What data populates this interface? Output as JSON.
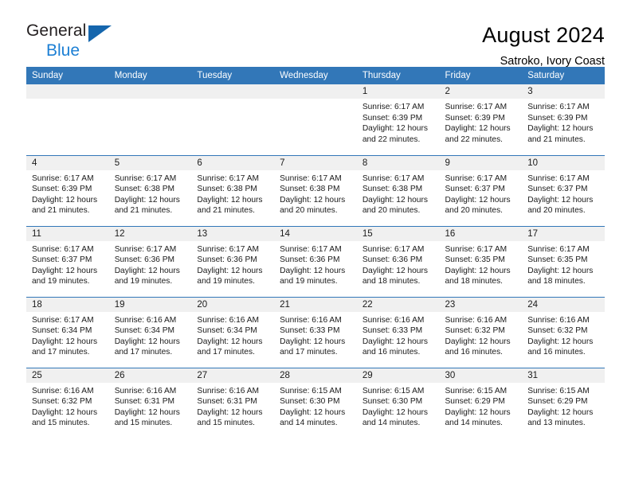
{
  "brand": {
    "name_top": "General",
    "name_bottom": "Blue",
    "accent_color": "#1c7fd4",
    "triangle_color": "#1566ad"
  },
  "header": {
    "title": "August 2024",
    "subtitle": "Satroko, Ivory Coast",
    "header_bg": "#3277b8",
    "daynum_bg": "#f0f0f0"
  },
  "weekdays": [
    "Sunday",
    "Monday",
    "Tuesday",
    "Wednesday",
    "Thursday",
    "Friday",
    "Saturday"
  ],
  "labels": {
    "sunrise": "Sunrise:",
    "sunset": "Sunset:",
    "daylight": "Daylight:"
  },
  "weeks": [
    [
      {
        "day": "",
        "empty": true
      },
      {
        "day": "",
        "empty": true
      },
      {
        "day": "",
        "empty": true
      },
      {
        "day": "",
        "empty": true
      },
      {
        "day": "1",
        "sunrise": "Sunrise: 6:17 AM",
        "sunset": "Sunset: 6:39 PM",
        "daylight1": "Daylight: 12 hours",
        "daylight2": "and 22 minutes."
      },
      {
        "day": "2",
        "sunrise": "Sunrise: 6:17 AM",
        "sunset": "Sunset: 6:39 PM",
        "daylight1": "Daylight: 12 hours",
        "daylight2": "and 22 minutes."
      },
      {
        "day": "3",
        "sunrise": "Sunrise: 6:17 AM",
        "sunset": "Sunset: 6:39 PM",
        "daylight1": "Daylight: 12 hours",
        "daylight2": "and 21 minutes."
      }
    ],
    [
      {
        "day": "4",
        "sunrise": "Sunrise: 6:17 AM",
        "sunset": "Sunset: 6:39 PM",
        "daylight1": "Daylight: 12 hours",
        "daylight2": "and 21 minutes."
      },
      {
        "day": "5",
        "sunrise": "Sunrise: 6:17 AM",
        "sunset": "Sunset: 6:38 PM",
        "daylight1": "Daylight: 12 hours",
        "daylight2": "and 21 minutes."
      },
      {
        "day": "6",
        "sunrise": "Sunrise: 6:17 AM",
        "sunset": "Sunset: 6:38 PM",
        "daylight1": "Daylight: 12 hours",
        "daylight2": "and 21 minutes."
      },
      {
        "day": "7",
        "sunrise": "Sunrise: 6:17 AM",
        "sunset": "Sunset: 6:38 PM",
        "daylight1": "Daylight: 12 hours",
        "daylight2": "and 20 minutes."
      },
      {
        "day": "8",
        "sunrise": "Sunrise: 6:17 AM",
        "sunset": "Sunset: 6:38 PM",
        "daylight1": "Daylight: 12 hours",
        "daylight2": "and 20 minutes."
      },
      {
        "day": "9",
        "sunrise": "Sunrise: 6:17 AM",
        "sunset": "Sunset: 6:37 PM",
        "daylight1": "Daylight: 12 hours",
        "daylight2": "and 20 minutes."
      },
      {
        "day": "10",
        "sunrise": "Sunrise: 6:17 AM",
        "sunset": "Sunset: 6:37 PM",
        "daylight1": "Daylight: 12 hours",
        "daylight2": "and 20 minutes."
      }
    ],
    [
      {
        "day": "11",
        "sunrise": "Sunrise: 6:17 AM",
        "sunset": "Sunset: 6:37 PM",
        "daylight1": "Daylight: 12 hours",
        "daylight2": "and 19 minutes."
      },
      {
        "day": "12",
        "sunrise": "Sunrise: 6:17 AM",
        "sunset": "Sunset: 6:36 PM",
        "daylight1": "Daylight: 12 hours",
        "daylight2": "and 19 minutes."
      },
      {
        "day": "13",
        "sunrise": "Sunrise: 6:17 AM",
        "sunset": "Sunset: 6:36 PM",
        "daylight1": "Daylight: 12 hours",
        "daylight2": "and 19 minutes."
      },
      {
        "day": "14",
        "sunrise": "Sunrise: 6:17 AM",
        "sunset": "Sunset: 6:36 PM",
        "daylight1": "Daylight: 12 hours",
        "daylight2": "and 19 minutes."
      },
      {
        "day": "15",
        "sunrise": "Sunrise: 6:17 AM",
        "sunset": "Sunset: 6:36 PM",
        "daylight1": "Daylight: 12 hours",
        "daylight2": "and 18 minutes."
      },
      {
        "day": "16",
        "sunrise": "Sunrise: 6:17 AM",
        "sunset": "Sunset: 6:35 PM",
        "daylight1": "Daylight: 12 hours",
        "daylight2": "and 18 minutes."
      },
      {
        "day": "17",
        "sunrise": "Sunrise: 6:17 AM",
        "sunset": "Sunset: 6:35 PM",
        "daylight1": "Daylight: 12 hours",
        "daylight2": "and 18 minutes."
      }
    ],
    [
      {
        "day": "18",
        "sunrise": "Sunrise: 6:17 AM",
        "sunset": "Sunset: 6:34 PM",
        "daylight1": "Daylight: 12 hours",
        "daylight2": "and 17 minutes."
      },
      {
        "day": "19",
        "sunrise": "Sunrise: 6:16 AM",
        "sunset": "Sunset: 6:34 PM",
        "daylight1": "Daylight: 12 hours",
        "daylight2": "and 17 minutes."
      },
      {
        "day": "20",
        "sunrise": "Sunrise: 6:16 AM",
        "sunset": "Sunset: 6:34 PM",
        "daylight1": "Daylight: 12 hours",
        "daylight2": "and 17 minutes."
      },
      {
        "day": "21",
        "sunrise": "Sunrise: 6:16 AM",
        "sunset": "Sunset: 6:33 PM",
        "daylight1": "Daylight: 12 hours",
        "daylight2": "and 17 minutes."
      },
      {
        "day": "22",
        "sunrise": "Sunrise: 6:16 AM",
        "sunset": "Sunset: 6:33 PM",
        "daylight1": "Daylight: 12 hours",
        "daylight2": "and 16 minutes."
      },
      {
        "day": "23",
        "sunrise": "Sunrise: 6:16 AM",
        "sunset": "Sunset: 6:32 PM",
        "daylight1": "Daylight: 12 hours",
        "daylight2": "and 16 minutes."
      },
      {
        "day": "24",
        "sunrise": "Sunrise: 6:16 AM",
        "sunset": "Sunset: 6:32 PM",
        "daylight1": "Daylight: 12 hours",
        "daylight2": "and 16 minutes."
      }
    ],
    [
      {
        "day": "25",
        "sunrise": "Sunrise: 6:16 AM",
        "sunset": "Sunset: 6:32 PM",
        "daylight1": "Daylight: 12 hours",
        "daylight2": "and 15 minutes."
      },
      {
        "day": "26",
        "sunrise": "Sunrise: 6:16 AM",
        "sunset": "Sunset: 6:31 PM",
        "daylight1": "Daylight: 12 hours",
        "daylight2": "and 15 minutes."
      },
      {
        "day": "27",
        "sunrise": "Sunrise: 6:16 AM",
        "sunset": "Sunset: 6:31 PM",
        "daylight1": "Daylight: 12 hours",
        "daylight2": "and 15 minutes."
      },
      {
        "day": "28",
        "sunrise": "Sunrise: 6:15 AM",
        "sunset": "Sunset: 6:30 PM",
        "daylight1": "Daylight: 12 hours",
        "daylight2": "and 14 minutes."
      },
      {
        "day": "29",
        "sunrise": "Sunrise: 6:15 AM",
        "sunset": "Sunset: 6:30 PM",
        "daylight1": "Daylight: 12 hours",
        "daylight2": "and 14 minutes."
      },
      {
        "day": "30",
        "sunrise": "Sunrise: 6:15 AM",
        "sunset": "Sunset: 6:29 PM",
        "daylight1": "Daylight: 12 hours",
        "daylight2": "and 14 minutes."
      },
      {
        "day": "31",
        "sunrise": "Sunrise: 6:15 AM",
        "sunset": "Sunset: 6:29 PM",
        "daylight1": "Daylight: 12 hours",
        "daylight2": "and 13 minutes."
      }
    ]
  ]
}
